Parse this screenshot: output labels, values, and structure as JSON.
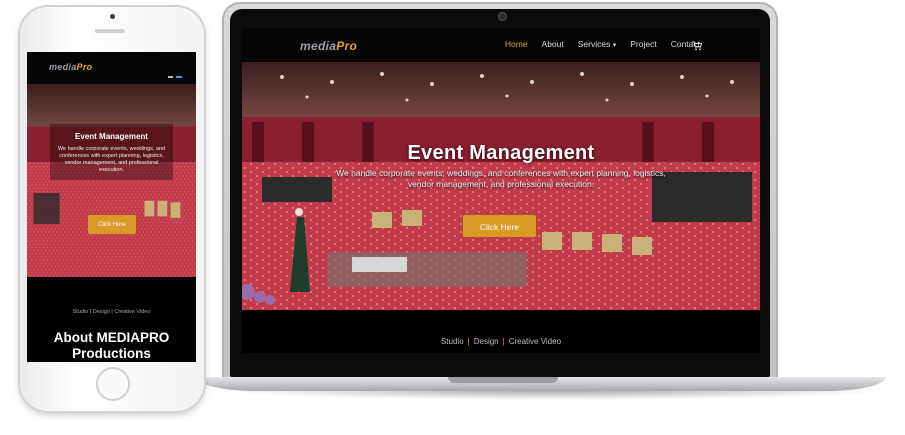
{
  "desktop": {
    "logo": {
      "part1": "media",
      "part2": "Pro"
    },
    "nav": {
      "home": "Home",
      "about": "About",
      "services": "Services",
      "services_caret": "▾",
      "project": "Project",
      "contact": "Contact",
      "cart_icon": "🛒"
    },
    "hero": {
      "title": "Event Management",
      "text": "We handle corporate events, weddings, and conferences with expert planning, logistics, vendor management, and professional execution.",
      "button": "Click Here"
    },
    "footer": {
      "items": [
        "Studio",
        "Design",
        "Creative Video"
      ],
      "separator": "|"
    }
  },
  "mobile": {
    "logo": {
      "part1": "media",
      "part2": "Pro"
    },
    "hero": {
      "title": "Event Management",
      "text": "We handle corporate events, weddings, and conferences with expert planning, logistics, vendor management, and professional execution.",
      "button": "Click Here"
    },
    "footer": {
      "items": [
        "Studio",
        "Design",
        "Creative Video"
      ],
      "separator": "|"
    },
    "about": {
      "line1": "About MEDIAPRO",
      "line2": "Productions"
    }
  },
  "colors": {
    "accent": "#e2a52a",
    "button": "#d99a26",
    "background": "#000000",
    "carpet": "#c43e4a"
  }
}
